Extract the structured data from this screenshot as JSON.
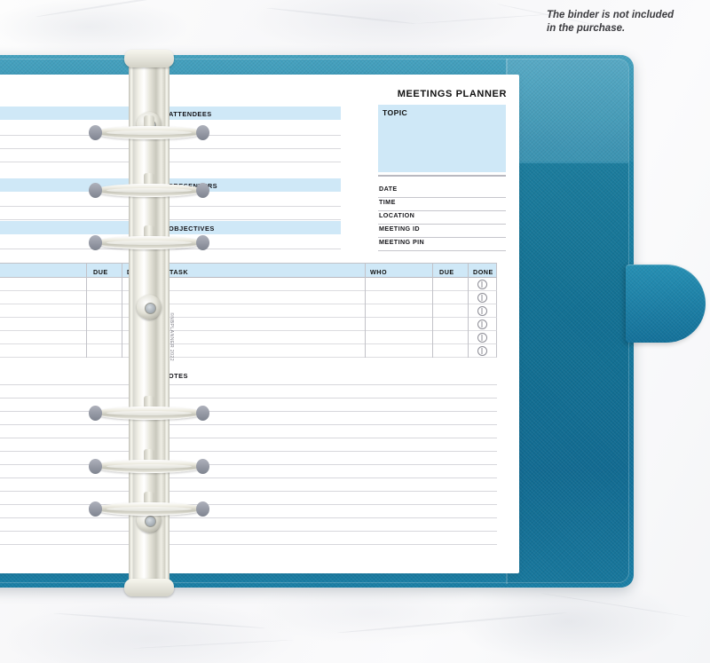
{
  "caption": {
    "line1": "The binder is not included",
    "line2": "in the purchase."
  },
  "colors": {
    "binder_teal": "#15789c",
    "binder_teal_light": "#2b94b6",
    "field_blue": "#cfe8f7",
    "rule_grey": "#d9d9dd",
    "text_dark": "#15151a",
    "marble_white": "#fbfbfc"
  },
  "planner": {
    "title": "MEETINGS PLANNER",
    "topic": {
      "label": "TOPIC",
      "value": ""
    },
    "meta_fields": [
      {
        "label": "DATE",
        "value": ""
      },
      {
        "label": "TIME",
        "value": ""
      },
      {
        "label": "LOCATION",
        "value": ""
      },
      {
        "label": "MEETING ID",
        "value": ""
      },
      {
        "label": "MEETING PIN",
        "value": ""
      }
    ],
    "sections": [
      {
        "label": "ATTENDEES",
        "lines": 3
      },
      {
        "label": "PRESENTERS",
        "lines": 2
      },
      {
        "label": "OBJECTIVES",
        "lines": 2
      }
    ],
    "task_table": {
      "columns": [
        "TASK",
        "WHO",
        "DUE",
        "DONE"
      ],
      "rows": [
        {
          "task": "",
          "who": "",
          "due": "",
          "done": "done-circle-icon"
        },
        {
          "task": "",
          "who": "",
          "due": "",
          "done": "done-circle-icon"
        },
        {
          "task": "",
          "who": "",
          "due": "",
          "done": "done-circle-icon"
        },
        {
          "task": "",
          "who": "",
          "due": "",
          "done": "done-circle-icon"
        },
        {
          "task": "",
          "who": "",
          "due": "",
          "done": "done-circle-icon"
        },
        {
          "task": "",
          "who": "",
          "due": "",
          "done": "done-circle-icon"
        }
      ]
    },
    "notes": {
      "label": "NOTES",
      "lines": 13
    },
    "copyright": "©NBPLANNER 2022"
  },
  "left_page": {
    "sections": [
      {
        "label": "",
        "lines": 3
      },
      {
        "label": "",
        "lines": 2
      },
      {
        "label": "",
        "lines": 2
      }
    ],
    "table_columns": [
      "DUE",
      "DONE"
    ],
    "table_rows": 6,
    "notes_lines": 13
  },
  "binder": {
    "ring_count": 6,
    "lever_count": 3,
    "closure_tab": "closure-tab"
  }
}
